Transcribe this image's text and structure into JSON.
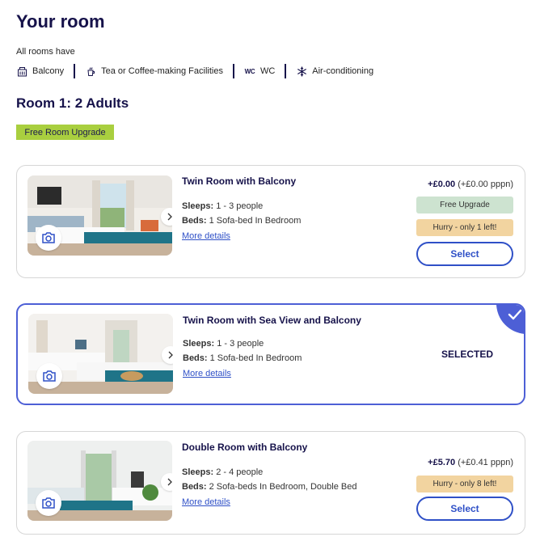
{
  "page": {
    "title": "Your room",
    "rooms_have": "All rooms have"
  },
  "amenities": [
    {
      "icon": "building-icon",
      "label": "Balcony"
    },
    {
      "icon": "kettle-icon",
      "label": "Tea or Coffee-making Facilities"
    },
    {
      "icon": "wc-icon",
      "icon_text": "WC",
      "label": "WC"
    },
    {
      "icon": "snowflake-icon",
      "label": "Air-conditioning"
    }
  ],
  "room_group": {
    "heading": "Room 1: 2 Adults",
    "banner": "Free Room Upgrade"
  },
  "rooms": [
    {
      "name": "Twin Room with Balcony",
      "sleeps_label": "Sleeps:",
      "sleeps_value": "1 - 3 people",
      "beds_label": "Beds:",
      "beds_value": "1 Sofa-bed In Bedroom",
      "more_details": "More details",
      "price_main": "+£0.00",
      "price_pppn": "(+£0.00 pppn)",
      "tag_free": "Free Upgrade",
      "tag_hurry": "Hurry - only 1 left!",
      "button": "Select"
    },
    {
      "name": "Twin Room with Sea View and Balcony",
      "sleeps_label": "Sleeps:",
      "sleeps_value": "1 - 3 people",
      "beds_label": "Beds:",
      "beds_value": "1 Sofa-bed In Bedroom",
      "more_details": "More details",
      "status": "SELECTED"
    },
    {
      "name": "Double Room with Balcony",
      "sleeps_label": "Sleeps:",
      "sleeps_value": "2 - 4 people",
      "beds_label": "Beds:",
      "beds_value": "2 Sofa-beds In Bedroom, Double Bed",
      "more_details": "More details",
      "price_main": "+£5.70",
      "price_pppn": "(+£0.41 pppn)",
      "tag_hurry": "Hurry - only 8 left!",
      "button": "Select"
    }
  ],
  "colors": {
    "navy": "#16124a",
    "accent_blue": "#2f50c7",
    "selected_border": "#4d5fd6",
    "banner_green": "#a9cf3f",
    "tag_green": "#cde3d0",
    "tag_orange": "#f2d4a0"
  }
}
